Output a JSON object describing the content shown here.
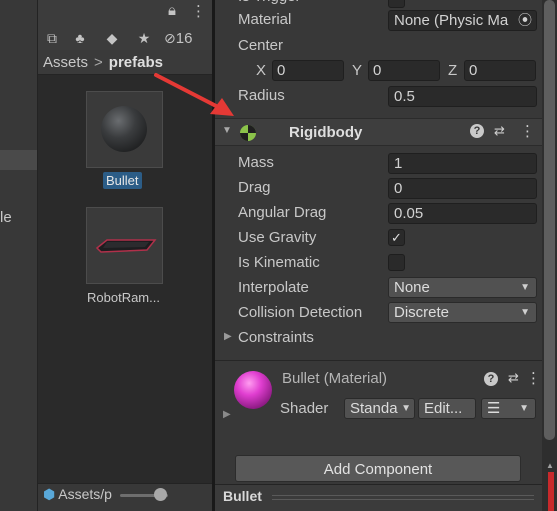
{
  "project": {
    "tree_partial_label": "le",
    "hidden_count": "16",
    "breadcrumb": {
      "root": "Assets",
      "separator": ">",
      "current": "prefabs"
    },
    "assets": [
      {
        "label": "Bullet",
        "icon": "sphere-prefab-thumbnail",
        "selected": true
      },
      {
        "label": "RobotRam...",
        "icon": "robot-ramp-thumbnail",
        "selected": false
      }
    ],
    "path_status": "Assets/p"
  },
  "inspector": {
    "material_label": "Material",
    "material_value": "None (Physic Ma",
    "center_label": "Center",
    "center": {
      "x_label": "X",
      "x": "0",
      "y_label": "Y",
      "y": "0",
      "z_label": "Z",
      "z": "0"
    },
    "radius_label": "Radius",
    "radius": "0.5",
    "rigidbody": {
      "title": "Rigidbody",
      "mass_label": "Mass",
      "mass": "1",
      "drag_label": "Drag",
      "drag": "0",
      "angular_drag_label": "Angular Drag",
      "angular_drag": "0.05",
      "use_gravity_label": "Use Gravity",
      "use_gravity": true,
      "is_kinematic_label": "Is Kinematic",
      "is_kinematic": false,
      "interpolate_label": "Interpolate",
      "interpolate": "None",
      "collision_label": "Collision Detection",
      "collision": "Discrete",
      "constraints_label": "Constraints"
    },
    "material_block": {
      "title": "Bullet (Material)",
      "shader_label": "Shader",
      "shader_value": "Standa",
      "edit_label": "Edit..."
    },
    "add_component_label": "Add Component",
    "preview_title": "Bullet"
  },
  "colors": {
    "selection_blue": "#2c5d87",
    "rigidbody_icon_green": "#8bc34a",
    "material_magenta": "#e03ed0",
    "annotation_red": "#e53935"
  }
}
